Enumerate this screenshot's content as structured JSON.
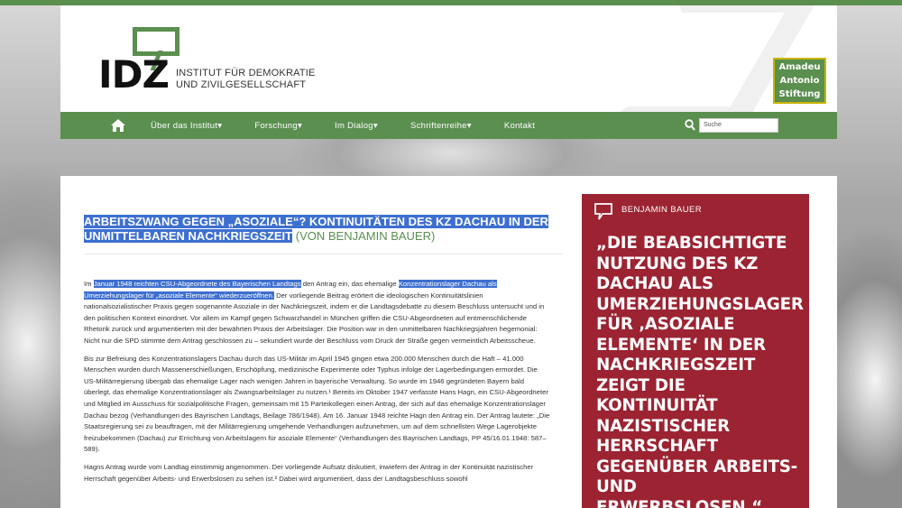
{
  "site": {
    "logo_letters": "IDZ",
    "logo_line1": "Institut für Demokratie",
    "logo_line2": "und Zivilgesellschaft",
    "partner_lines": [
      "Amadeu",
      "Antonio",
      "Stiftung"
    ]
  },
  "nav": {
    "items": [
      "Über das Institut",
      "Forschung",
      "Im Dialog",
      "Schriftenreihe",
      "Kontakt"
    ],
    "search_placeholder": "Suche"
  },
  "article": {
    "title_highlighted": "Arbeitszwang gegen „Asoziale“? Kontinuitäten des KZ Dachau in der unmittelbaren Nachkriegszeit",
    "author_suffix": "(von Benjamin Bauer)",
    "p1": {
      "t1": "Im ",
      "h1": "Januar 1948 reichten CSU-Abgeordnete des Bayerischen Landtags",
      "t2": " den Antrag ein, das ehemalige ",
      "h2": "Konzentrationslager Dachau als Umerziehungslager für „asoziale Elemente“ wiederzueröffnen.",
      "t3": " Der vorliegende Beitrag erörtert die ideologischen Kontinuitätslinien nationalsozialistischer Praxis gegen sogenannte Asoziale in der Nachkriegszeit, indem er die Landtagsdebatte zu diesem Beschluss untersucht und in den politischen Kontext einordnet. Vor allem im Kampf gegen Schwarzhandel in München griffen die CSU-Abgeordneten auf entmenschlichende Rhetorik zurück und argumentierten mit der bewährten Praxis der Arbeitslager. Die Position war in den unmittelbaren Nachkriegsjahren hegemonial: Nicht nur die SPD stimmte dem Antrag geschlossen zu – sekundiert wurde der Beschluss vom Druck der Straße gegen vermeintlich Arbeitsscheue."
    },
    "p2": "Bis zur Befreiung des Konzentrationslagers Dachau durch das US-Militär im April 1945 gingen etwa 200.000 Menschen durch die Haft – 41.000 Menschen wurden durch Massenerschießungen, Erschöpfung, medizinische Experimente oder Typhus infolge der Lagerbedingungen ermordet. Die US-Militärregierung übergab das ehemalige Lager nach wenigen Jahren in bayerische Verwaltung. So wurde im 1946 gegründeten Bayern bald überlegt, das ehemalige Konzentrationslager als Zwangsarbeitslager zu nutzen.¹ Bereits im Oktober 1947 verfasste Hans Hagn, ein CSU-Abgeordneter und Mitglied im Ausschuss für sozialpolitische Fragen, gemeinsam mit 15 Parteikollegen einen Antrag, der sich auf das ehemalige Konzentrationslager Dachau bezog (Verhandlungen des Bayrischen Landtags, Beilage 786/1948). Am 16. Januar 1948 reichte Hagn den Antrag ein. Der Antrag lautete: „Die Staatsregierung sei zu beauftragen, mit der Militärregierung umgehende Verhandlungen aufzunehmen, um auf dem schnellsten Wege Lagerobjekte freizubekommen (Dachau) zur Errichtung von Arbeitslagern für asoziale Elemente“ (Verhandlungen des Bayrischen Landtags, PP 45/16.01.1948: 587–589).",
    "p3": "Hagns Antrag wurde vom Landtag einstimmig angenommen. Der vorliegende Aufsatz diskutiert, inwiefern der Antrag in der Kontinuität nazistischer Herrschaft gegenüber Arbeits- und Erwerbslosen zu sehen ist.² Dabei wird argumentiert, dass der Landtagsbeschluss sowohl"
  },
  "quote": {
    "author": "Benjamin Bauer",
    "text": "„Die beabsichtigte Nutzung des KZ Dachau als Umerziehungslager für ‚asoziale Elemente‘ in der Nachkriegszeit zeigt die Kontinuität nazistischer Herrschaft gegenüber Arbeits- und Erwerbslosen.“"
  },
  "colors": {
    "brand_green": "#5a8f4f",
    "quote_red": "#9b2332",
    "selection_blue": "#3d6fd0"
  }
}
